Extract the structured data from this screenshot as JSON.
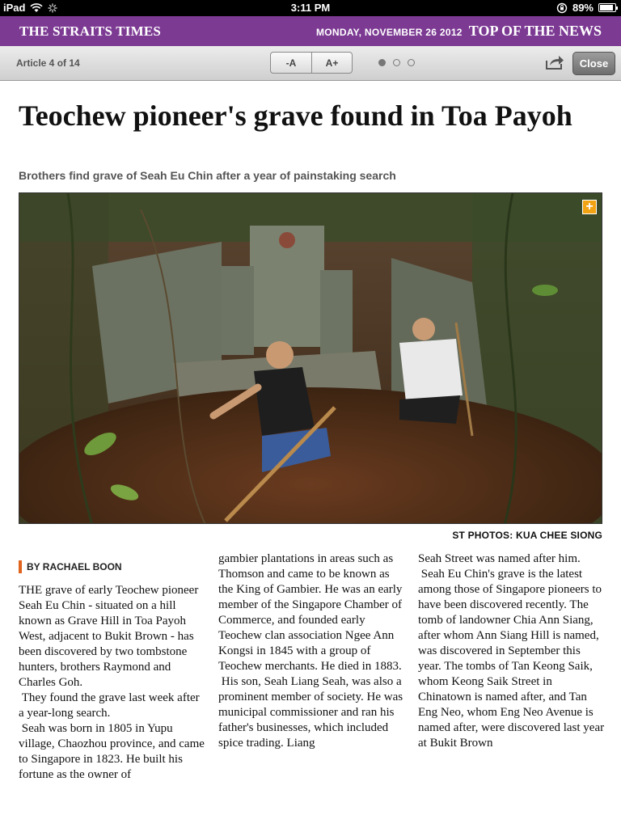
{
  "status_bar": {
    "device": "iPad",
    "time": "3:11 PM",
    "battery": "89%",
    "battery_level": 0.89
  },
  "brand_bar": {
    "publication": "THE STRAITS TIMES",
    "date": "MONDAY, NOVEMBER 26 2012",
    "section": "TOP OF THE NEWS",
    "color": "#7c3a93"
  },
  "toolbar": {
    "article_count": "Article 4 of 14",
    "font_decrease": "-A",
    "font_increase": "A+",
    "page_dots": 3,
    "active_dot": 0,
    "share_icon": "share-icon",
    "close_label": "Close"
  },
  "article": {
    "headline": "Teochew pioneer's grave found in Toa Payoh",
    "subhead": "Brothers find grave of Seah Eu Chin after a year of painstaking search",
    "photo_credit": "ST PHOTOS: KUA CHEE SIONG",
    "expand_icon": "plus-icon",
    "byline": "BY RACHAEL BOON",
    "byline_accent": "#e0641e",
    "columns": [
      {
        "paragraphs": [
          "THE grave of early Teochew pioneer Seah Eu Chin - situated on a hill known as Grave Hill in Toa Payoh West, adjacent to Bukit Brown - has been discovered by two tombstone hunters, brothers Raymond and Charles Goh.",
          " They found the grave last week after a year-long search.",
          " Seah was born in 1805 in Yupu village, Chaozhou province, and came to Singapore in 1823. He built his fortune as the owner of"
        ]
      },
      {
        "paragraphs": [
          "gambier plantations in areas such as Thomson and came to be known as the King of Gambier. He was an early member of the Singapore Chamber of Commerce, and founded early Teochew clan association Ngee Ann Kongsi in 1845 with a group of Teochew merchants. He died in 1883.",
          " His son, Seah Liang Seah, was also a prominent member of society. He was municipal commissioner and ran his father's businesses, which included spice trading. Liang"
        ]
      },
      {
        "paragraphs": [
          "Seah Street was named after him.",
          " Seah Eu Chin's grave is the latest among those of Singapore pioneers to have been discovered recently. The tomb of landowner Chia Ann Siang, after whom Ann Siang Hill is named, was discovered in September this year. The tombs of Tan Keong Saik, whom Keong Saik Street in Chinatown is named after, and Tan Eng Neo, whom Eng Neo Avenue is named after, were discovered last year at Bukit Brown"
        ]
      }
    ]
  }
}
